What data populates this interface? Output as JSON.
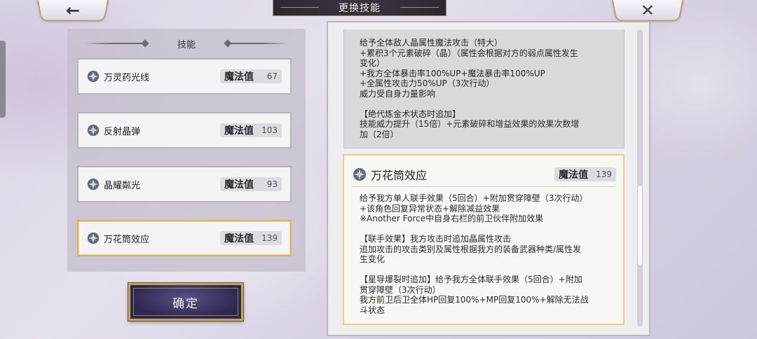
{
  "header": {
    "title": "更换技能",
    "back_icon": "←",
    "close_icon": "✕"
  },
  "list": {
    "header": "技能",
    "items": [
      {
        "name": "万灵药光线",
        "mp_label": "魔法值",
        "mp": "67",
        "selected": false
      },
      {
        "name": "反射晶弹",
        "mp_label": "魔法值",
        "mp": "103",
        "selected": false
      },
      {
        "name": "晶耀粼光",
        "mp_label": "魔法值",
        "mp": "93",
        "selected": false
      },
      {
        "name": "万花筒效应",
        "mp_label": "魔法值",
        "mp": "139",
        "selected": true
      }
    ]
  },
  "confirm_label": "确定",
  "detail_prev": {
    "text": "给予全体敌人晶属性魔法攻击（特大）\n+累积3个元素破碎（晶）（属性会根据对方的弱点属性发生\n变化）\n+我方全体暴击率100%UP+魔法暴击率100%UP\n+全属性攻击力50%UP（3次行动）\n威力受自身力量影响\n\n【绝代炼金术状态时追加】\n技能威力提升（15倍）+元素破碎和增益效果的效果次数增\n加（2倍）"
  },
  "detail": {
    "name": "万花筒效应",
    "mp_label": "魔法值",
    "mp": "139",
    "description": "给予我方单人联手效果（5回合）+附加贯穿障壁（3次行动）\n+该角色回复异常状态+解除减益效果\n※Another Force中自身右栏的前卫伙伴附加效果\n\n【联手效果】我方攻击时追加晶属性攻击\n追加攻击的攻击类别及属性根据我方的装备武器种类/属性发\n生变化\n\n【星导爆裂时追加】给予我方全体联手效果（5回合）+附加\n贯穿障壁（3次行动）\n我方前卫后卫全体HP回复100%+MP回复100%+解除无法战\n斗状态"
  },
  "scrollbar": {
    "position_fraction": 0.72
  },
  "colors": {
    "selected_border": "#d8b25e",
    "confirm_bg": "#2e2850",
    "gold": "#c7a55c"
  },
  "icons": {
    "skill": "crystal-sparkle-icon"
  }
}
